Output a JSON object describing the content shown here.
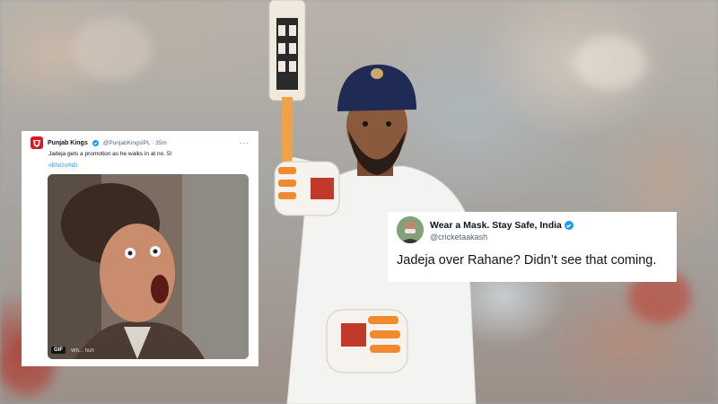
{
  "left_tweet": {
    "name": "Punjab Kings",
    "handle": "@PunjabKingsIPL · 35m",
    "more": "···",
    "text": "Jadeja gets a promotion as he walks in at no. 5!",
    "hashtag": "#ENGvIND",
    "gif_badge": "GIF",
    "gif_caption": "Wh... huh",
    "verified_icon": "verified-badge-icon",
    "avatar_icon": "punjab-kings-logo-icon"
  },
  "right_tweet": {
    "name": "Wear a Mask. Stay Safe, India",
    "handle": "@cricketaakash",
    "text": "Jadeja over Rahane? Didn’t see that coming.",
    "verified_icon": "verified-badge-icon"
  },
  "colors": {
    "twitter_blue": "#1d9bf0",
    "punjab_red": "#d71920",
    "helmet_navy": "#1f2a55",
    "glove_orange": "#f08a2c"
  }
}
